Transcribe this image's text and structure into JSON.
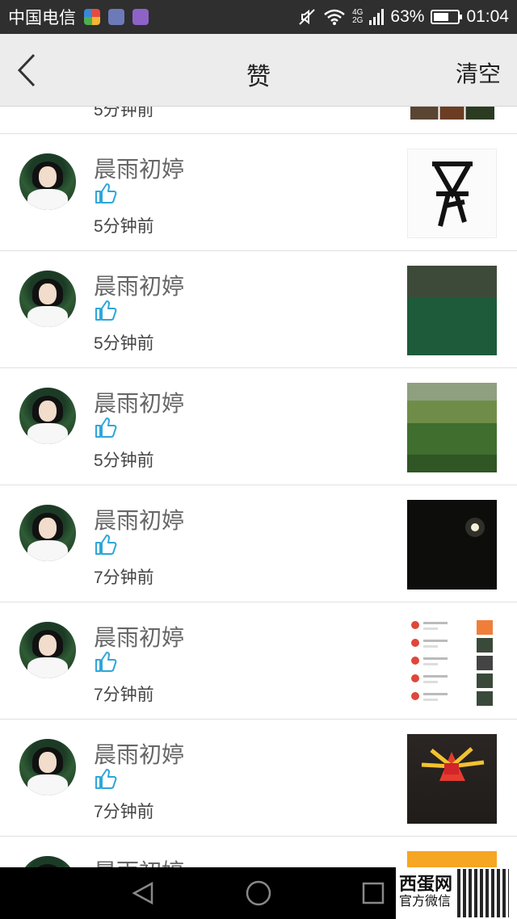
{
  "status_bar": {
    "carrier": "中国电信",
    "network_top": "4G",
    "network_bottom": "2G",
    "battery": "63%",
    "battery_level": 0.63,
    "time": "01:04"
  },
  "nav": {
    "title": "赞",
    "clear_label": "清空"
  },
  "partial_item": {
    "time": "5分钟前"
  },
  "likes": [
    {
      "name": "晨雨初婷",
      "time": "5分钟前"
    },
    {
      "name": "晨雨初婷",
      "time": "5分钟前"
    },
    {
      "name": "晨雨初婷",
      "time": "5分钟前"
    },
    {
      "name": "晨雨初婷",
      "time": "7分钟前"
    },
    {
      "name": "晨雨初婷",
      "time": "7分钟前"
    },
    {
      "name": "晨雨初婷",
      "time": "7分钟前"
    },
    {
      "name": "晨雨初婷",
      "time": ""
    }
  ],
  "watermark": {
    "brand": "西蛋网",
    "subtitle": "官方微信"
  },
  "colors": {
    "like_icon": "#2ea6d9",
    "nav_bg": "#ececec",
    "status_bg": "#2f2f2f"
  }
}
